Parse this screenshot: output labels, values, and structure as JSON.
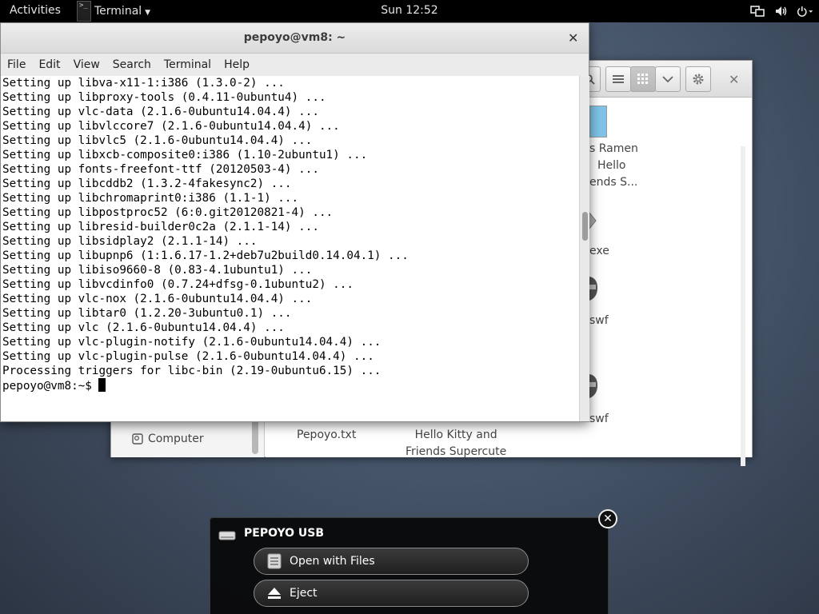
{
  "topbar": {
    "activities": "Activities",
    "app_name": "Terminal",
    "app_icon_text": ">_",
    "clock": "Sun 12:52",
    "tray_icons": [
      "network-icon",
      "volume-icon",
      "power-icon"
    ]
  },
  "terminal": {
    "title": "pepoyo@vm8: ~",
    "menu": [
      "File",
      "Edit",
      "View",
      "Search",
      "Terminal",
      "Help"
    ],
    "lines": [
      "Setting up libva-x11-1:i386 (1.3.0-2) ...",
      "Setting up libproxy-tools (0.4.11-0ubuntu4) ...",
      "Setting up vlc-data (2.1.6-0ubuntu14.04.4) ...",
      "Setting up libvlccore7 (2.1.6-0ubuntu14.04.4) ...",
      "Setting up libvlc5 (2.1.6-0ubuntu14.04.4) ...",
      "Setting up libxcb-composite0:i386 (1.10-2ubuntu1) ...",
      "Setting up fonts-freefont-ttf (20120503-4) ...",
      "Setting up libcddb2 (1.3.2-4fakesync2) ...",
      "Setting up libchromaprint0:i386 (1.1-1) ...",
      "Setting up libpostproc52 (6:0.git20120821-4) ...",
      "Setting up libresid-builder0c2a (2.1.1-14) ...",
      "Setting up libsidplay2 (2.1.1-14) ...",
      "Setting up libupnp6 (1:1.6.17-1.2+deb7u2build0.14.04.1) ...",
      "Setting up libiso9660-8 (0.83-4.1ubuntu1) ...",
      "Setting up libvcdinfo0 (0.7.24+dfsg-0.1ubuntu2) ...",
      "Setting up vlc-nox (2.1.6-0ubuntu14.04.4) ...",
      "Setting up libtar0 (1.2.20-3ubuntu0.1) ...",
      "Setting up vlc (2.1.6-0ubuntu14.04.4) ...",
      "Setting up vlc-plugin-notify (2.1.6-0ubuntu14.04.4) ...",
      "Setting up vlc-plugin-pulse (2.1.6-0ubuntu14.04.4) ...",
      "Processing triggers for libc-bin (2.19-0ubuntu6.15) ..."
    ],
    "prompt": "pepoyo@vm8:~$"
  },
  "files": {
    "sidebar_computer": "Computer",
    "visible_items": [
      {
        "line1": "s Ramen",
        "line2": "Hello",
        "line3": "ends S..."
      },
      {
        "line1": "exe"
      },
      {
        "line1": "swf"
      },
      {
        "line1": "swf"
      },
      {
        "line1": "Pepoyo.txt"
      },
      {
        "line1": "Hello Kitty and",
        "line2": "Friends Supercute"
      }
    ]
  },
  "usb": {
    "title": "PEPOYO USB",
    "open_label": "Open with Files",
    "eject_label": "Eject"
  }
}
